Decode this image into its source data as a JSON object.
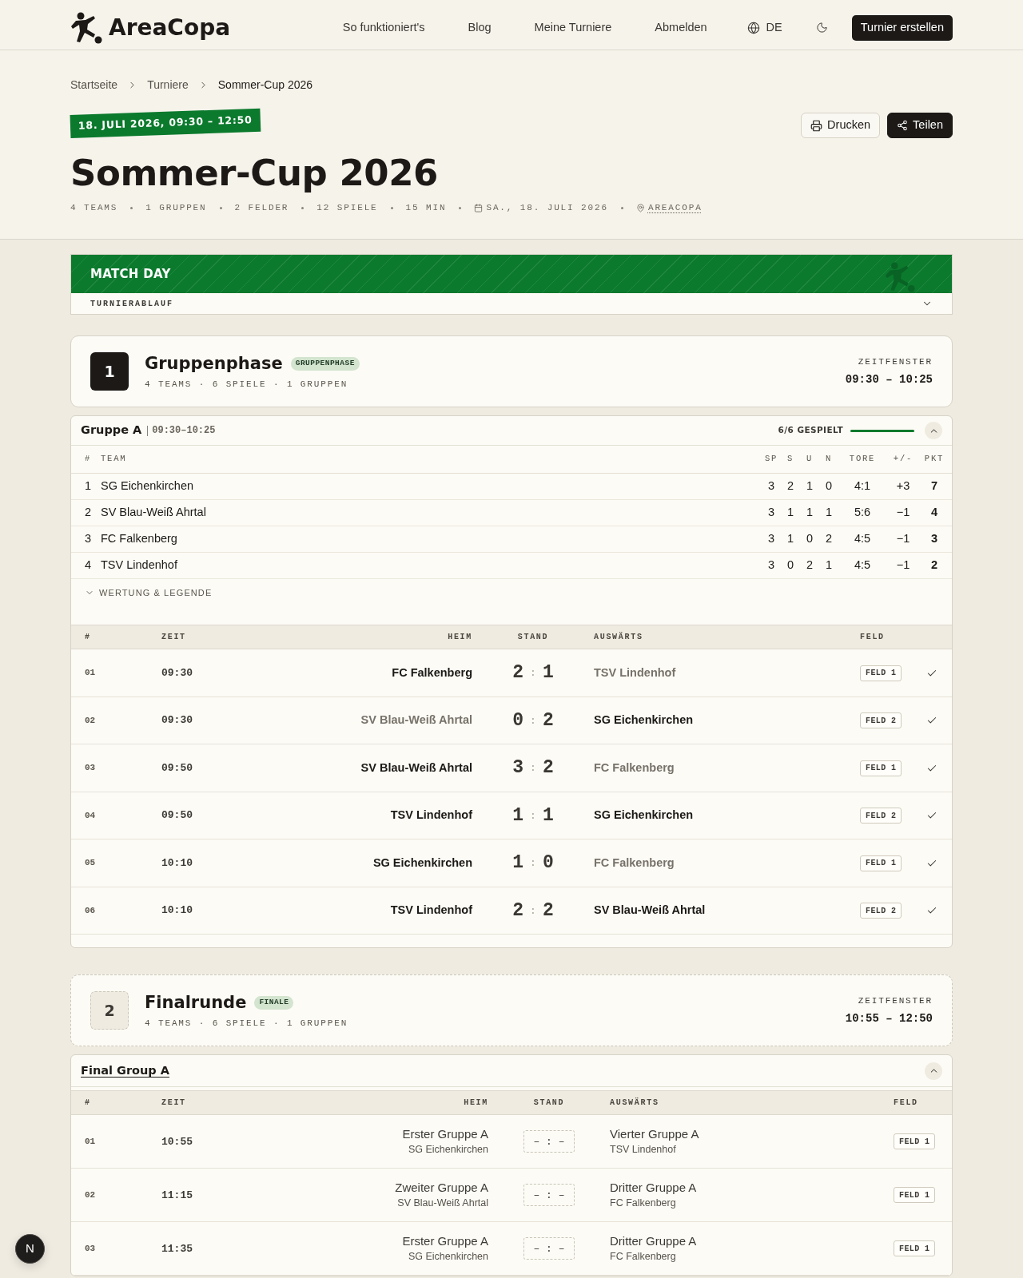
{
  "header": {
    "logo": "AreaCopa",
    "nav": [
      {
        "label": "So funktioniert's"
      },
      {
        "label": "Blog"
      },
      {
        "label": "Meine Turniere"
      },
      {
        "label": "Abmelden"
      }
    ],
    "language": "DE",
    "cta": "Turnier erstellen"
  },
  "breadcrumb": [
    {
      "label": "Startseite",
      "current": false
    },
    {
      "label": "Turniere",
      "current": false
    },
    {
      "label": "Sommer-Cup 2026",
      "current": true
    }
  ],
  "hero": {
    "date_badge": "18. JULI 2026, 09:30 – 12:50",
    "actions": [
      {
        "label": "Drucken",
        "kind": "print"
      },
      {
        "label": "Teilen",
        "kind": "share"
      }
    ],
    "title": "Sommer-Cup 2026",
    "meta": [
      {
        "kind": "stat",
        "text": "4 TEAMS"
      },
      {
        "kind": "stat",
        "text": "1 GRUPPEN"
      },
      {
        "kind": "stat",
        "text": "2 FELDER"
      },
      {
        "kind": "stat",
        "text": "12 SPIELE"
      },
      {
        "kind": "stat",
        "text": "15 MIN"
      },
      {
        "kind": "date",
        "text": "SA., 18. JULI 2026"
      },
      {
        "kind": "location",
        "text": "AREACOPA"
      }
    ]
  },
  "match_day": {
    "title": "MATCH DAY",
    "subtitle": "TURNIERABLAUF",
    "expanded": false
  },
  "stages": [
    {
      "number": "1",
      "title": "Gruppenphase",
      "badge": "GRUPPENPHASE",
      "meta": "4 TEAMS · 6 SPIELE · 1 GRUPPEN",
      "window_label": "ZEITFENSTER",
      "window": "09:30 – 10:25",
      "completed": true,
      "group": {
        "name": "Gruppe A",
        "linked": false,
        "time": "09:30–10:25",
        "progress": {
          "label": "6/6 GESPIELT",
          "level": 1
        },
        "expanded": true,
        "standings": {
          "columns": [
            "#",
            "TEAM",
            "SP",
            "S",
            "U",
            "N",
            "TORE",
            "+/-",
            "PKT"
          ],
          "rows": [
            [
              "1",
              "SG Eichenkirchen",
              "3",
              "2",
              "1",
              "0",
              "4:1",
              "+3",
              "7"
            ],
            [
              "2",
              "SV Blau-Weiß Ahrtal",
              "3",
              "1",
              "1",
              "1",
              "5:6",
              "−1",
              "4"
            ],
            [
              "3",
              "FC Falkenberg",
              "3",
              "1",
              "0",
              "2",
              "4:5",
              "−1",
              "3"
            ],
            [
              "4",
              "TSV Lindenhof",
              "3",
              "0",
              "2",
              "1",
              "4:5",
              "−1",
              "2"
            ]
          ]
        },
        "legend": {
          "label": "WERTUNG & LEGENDE",
          "expanded": false
        },
        "matches": {
          "columns": [
            "#",
            "ZEIT",
            "HEIM",
            "STAND",
            "AUSWÄRTS",
            "FELD"
          ],
          "rows": [
            {
              "kind": "played",
              "no": "01",
              "time": "09:30",
              "home": "FC Falkenberg",
              "home_dimmed": false,
              "score": {
                "home": "2",
                "separator": ":",
                "away": "1"
              },
              "away": "TSV Lindenhof",
              "away_dimmed": true,
              "field": "FELD 1",
              "finished": true
            },
            {
              "kind": "played",
              "no": "02",
              "time": "09:30",
              "home": "SV Blau-Weiß Ahrtal",
              "home_dimmed": true,
              "score": {
                "home": "0",
                "separator": ":",
                "away": "2"
              },
              "away": "SG Eichenkirchen",
              "away_dimmed": false,
              "field": "FELD 2",
              "finished": true
            },
            {
              "kind": "played",
              "no": "03",
              "time": "09:50",
              "home": "SV Blau-Weiß Ahrtal",
              "home_dimmed": false,
              "score": {
                "home": "3",
                "separator": ":",
                "away": "2"
              },
              "away": "FC Falkenberg",
              "away_dimmed": true,
              "field": "FELD 1",
              "finished": true
            },
            {
              "kind": "played",
              "no": "04",
              "time": "09:50",
              "home": "TSV Lindenhof",
              "home_dimmed": false,
              "score": {
                "home": "1",
                "separator": ":",
                "away": "1"
              },
              "away": "SG Eichenkirchen",
              "away_dimmed": false,
              "field": "FELD 2",
              "finished": true
            },
            {
              "kind": "played",
              "no": "05",
              "time": "10:10",
              "home": "SG Eichenkirchen",
              "home_dimmed": false,
              "score": {
                "home": "1",
                "separator": ":",
                "away": "0"
              },
              "away": "FC Falkenberg",
              "away_dimmed": true,
              "field": "FELD 1",
              "finished": true
            },
            {
              "kind": "played",
              "no": "06",
              "time": "10:10",
              "home": "TSV Lindenhof",
              "home_dimmed": false,
              "score": {
                "home": "2",
                "separator": ":",
                "away": "2"
              },
              "away": "SV Blau-Weiß Ahrtal",
              "away_dimmed": false,
              "field": "FELD 2",
              "finished": true
            }
          ]
        }
      }
    },
    {
      "number": "2",
      "title": "Finalrunde",
      "badge": "FINALE",
      "meta": "4 TEAMS · 6 SPIELE · 1 GRUPPEN",
      "window_label": "ZEITFENSTER",
      "window": "10:55 – 12:50",
      "completed": false,
      "group": {
        "name": "Final Group A",
        "linked": true,
        "expanded": true,
        "matches": {
          "columns": [
            "#",
            "ZEIT",
            "HEIM",
            "STAND",
            "AUSWÄRTS",
            "FELD"
          ],
          "rows": [
            {
              "kind": "scheduled",
              "no": "01",
              "time": "10:55",
              "home": "Erster Gruppe A",
              "home_team": "SG Eichenkirchen",
              "score": "– : –",
              "away": "Vierter Gruppe A",
              "away_team": "TSV Lindenhof",
              "field": "FELD 1"
            },
            {
              "kind": "scheduled",
              "no": "02",
              "time": "11:15",
              "home": "Zweiter Gruppe A",
              "home_team": "SV Blau-Weiß Ahrtal",
              "score": "– : –",
              "away": "Dritter Gruppe A",
              "away_team": "FC Falkenberg",
              "field": "FELD 1"
            },
            {
              "kind": "scheduled",
              "no": "03",
              "time": "11:35",
              "home": "Erster Gruppe A",
              "home_team": "SG Eichenkirchen",
              "score": "– : –",
              "away": "Dritter Gruppe A",
              "away_team": "FC Falkenberg",
              "field": "FELD 1"
            }
          ]
        }
      }
    }
  ],
  "dev_badge": "N"
}
